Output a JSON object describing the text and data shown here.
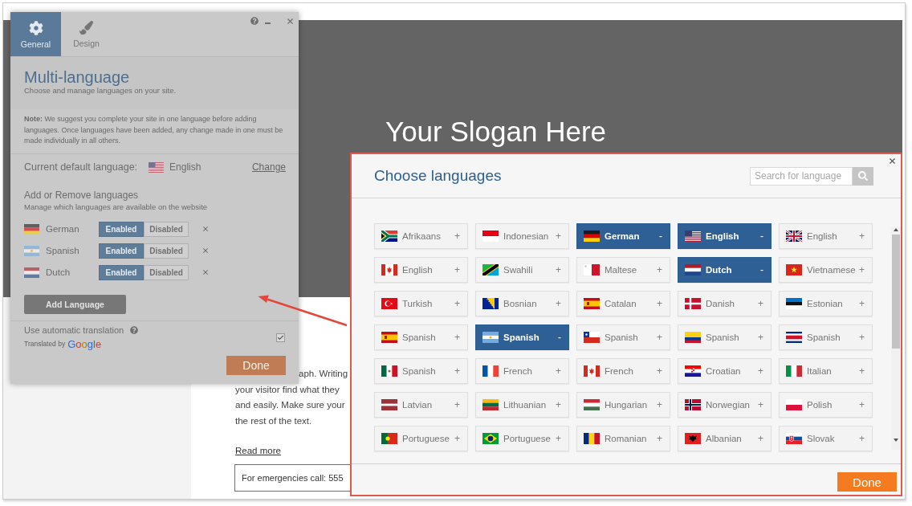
{
  "page": {
    "slogan": "Your Slogan Here",
    "paragraph_lines": [
      "aph. Writing",
      "your visitor find what they",
      "and easily. Make sure your",
      "the rest of the text."
    ],
    "link": "Read more",
    "notice": "For emergencies call: 555"
  },
  "settings_panel": {
    "tabs": [
      {
        "label": "General",
        "kind": "gear",
        "selected": true
      },
      {
        "label": "Design",
        "kind": "brush",
        "selected": false
      }
    ],
    "title": "Multi-language",
    "subtitle": "Choose and manage languages on your site.",
    "note": "**Note:** We suggest you complete your site in one language before adding languages. Once languages have been added, any change made in one must be made individually in all others.",
    "default_language": {
      "label": "Current default language:",
      "kind": "us",
      "name": "English",
      "action": "Change"
    },
    "section_title": "Add or Remove languages",
    "section_subtitle": "Manage which languages are available on the website",
    "languages": [
      {
        "name": "German",
        "kind": "de",
        "enabled": true,
        "on_label": "Enabled",
        "off_label": "Disabled"
      },
      {
        "name": "Spanish",
        "kind": "ar",
        "enabled": true,
        "on_label": "Enabled",
        "off_label": "Disabled"
      },
      {
        "name": "Dutch",
        "kind": "nl",
        "enabled": true,
        "on_label": "Enabled",
        "off_label": "Disabled"
      }
    ],
    "add_button": "Add Language",
    "auto_translation": {
      "label": "Use automatic translation",
      "checked": true,
      "credit": "Translated by",
      "provider": "Google"
    },
    "done_button": "Done"
  },
  "language_dialog": {
    "title": "Choose languages",
    "search": {
      "placeholder": "Search for language"
    },
    "languages": [
      {
        "name": "Afrikaans",
        "kind": "za",
        "selected": false,
        "sign": "+"
      },
      {
        "name": "Indonesian",
        "kind": "id",
        "selected": false,
        "sign": "+"
      },
      {
        "name": "German",
        "kind": "de",
        "selected": true,
        "sign": "-"
      },
      {
        "name": "English",
        "kind": "us",
        "selected": true,
        "sign": "-"
      },
      {
        "name": "English",
        "kind": "gb",
        "selected": false,
        "sign": "+"
      },
      {
        "name": "English",
        "kind": "ca",
        "selected": false,
        "sign": "+"
      },
      {
        "name": "Swahili",
        "kind": "tz",
        "selected": false,
        "sign": "+"
      },
      {
        "name": "Maltese",
        "kind": "mt",
        "selected": false,
        "sign": "+"
      },
      {
        "name": "Dutch",
        "kind": "nl",
        "selected": true,
        "sign": "-"
      },
      {
        "name": "Vietnamese",
        "kind": "vn",
        "selected": false,
        "sign": "+"
      },
      {
        "name": "Turkish",
        "kind": "tr",
        "selected": false,
        "sign": "+"
      },
      {
        "name": "Bosnian",
        "kind": "ba",
        "selected": false,
        "sign": "+"
      },
      {
        "name": "Catalan",
        "kind": "es",
        "selected": false,
        "sign": "+"
      },
      {
        "name": "Danish",
        "kind": "dk",
        "selected": false,
        "sign": "+"
      },
      {
        "name": "Estonian",
        "kind": "ee",
        "selected": false,
        "sign": "+"
      },
      {
        "name": "Spanish",
        "kind": "es",
        "selected": false,
        "sign": "+"
      },
      {
        "name": "Spanish",
        "kind": "ar",
        "selected": true,
        "sign": "-"
      },
      {
        "name": "Spanish",
        "kind": "cl",
        "selected": false,
        "sign": "+"
      },
      {
        "name": "Spanish",
        "kind": "co",
        "selected": false,
        "sign": "+"
      },
      {
        "name": "Spanish",
        "kind": "cr",
        "selected": false,
        "sign": "+"
      },
      {
        "name": "Spanish",
        "kind": "mx",
        "selected": false,
        "sign": "+"
      },
      {
        "name": "French",
        "kind": "fr",
        "selected": false,
        "sign": "+"
      },
      {
        "name": "French",
        "kind": "ca",
        "selected": false,
        "sign": "+"
      },
      {
        "name": "Croatian",
        "kind": "hr",
        "selected": false,
        "sign": "+"
      },
      {
        "name": "Italian",
        "kind": "it",
        "selected": false,
        "sign": "+"
      },
      {
        "name": "Latvian",
        "kind": "lv",
        "selected": false,
        "sign": "+"
      },
      {
        "name": "Lithuanian",
        "kind": "lt",
        "selected": false,
        "sign": "+"
      },
      {
        "name": "Hungarian",
        "kind": "hu",
        "selected": false,
        "sign": "+"
      },
      {
        "name": "Norwegian",
        "kind": "no",
        "selected": false,
        "sign": "+"
      },
      {
        "name": "Polish",
        "kind": "pl",
        "selected": false,
        "sign": "+"
      },
      {
        "name": "Portuguese",
        "kind": "pt",
        "selected": false,
        "sign": "+"
      },
      {
        "name": "Portuguese",
        "kind": "br",
        "selected": false,
        "sign": "+"
      },
      {
        "name": "Romanian",
        "kind": "ro",
        "selected": false,
        "sign": "+"
      },
      {
        "name": "Albanian",
        "kind": "al",
        "selected": false,
        "sign": "+"
      },
      {
        "name": "Slovak",
        "kind": "sk",
        "selected": false,
        "sign": "+"
      }
    ],
    "done_button": "Done"
  }
}
